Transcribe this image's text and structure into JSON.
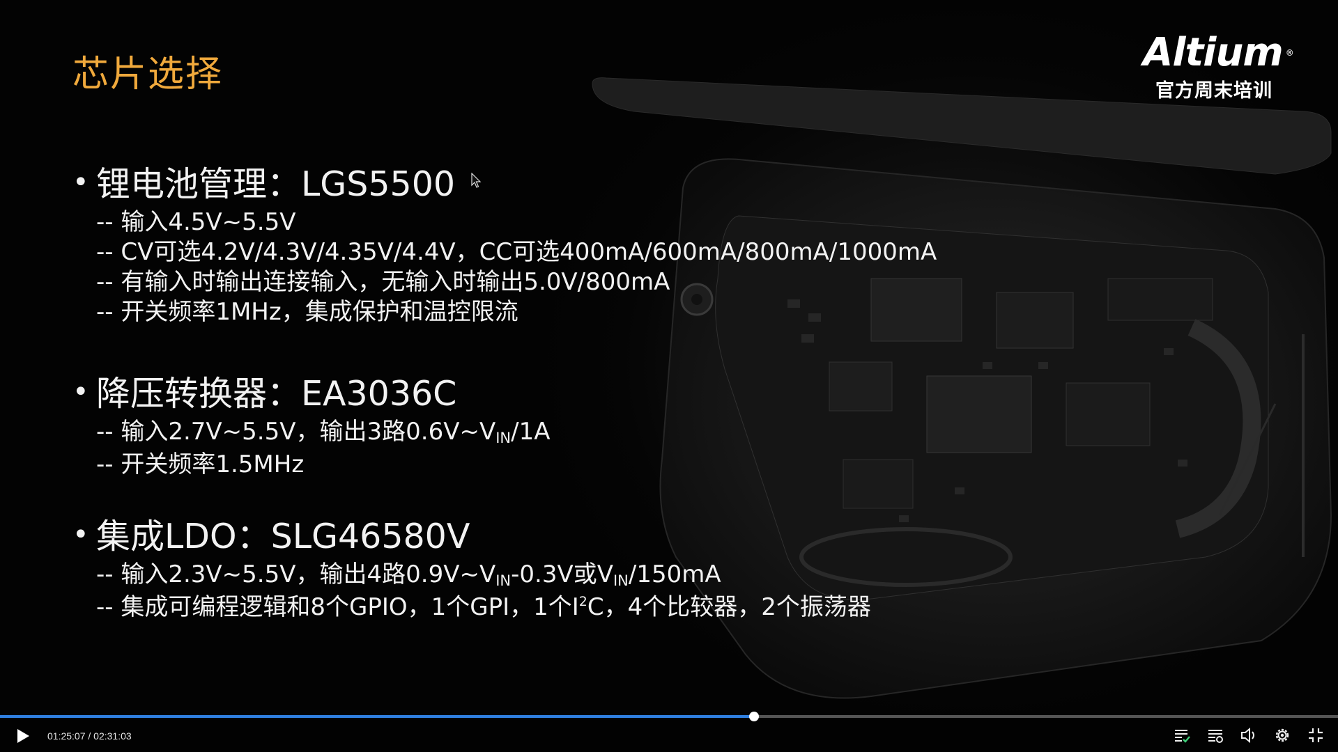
{
  "slide": {
    "title": "芯片选择",
    "logo": {
      "brand": "Altium",
      "registered": "®",
      "subtitle": "官方周末培训"
    },
    "sections": [
      {
        "heading": "锂电池管理：LGS5500",
        "items": [
          "-- 输入4.5V~5.5V",
          "-- CV可选4.2V/4.3V/4.35V/4.4V，CC可选400mA/600mA/800mA/1000mA",
          "-- 有输入时输出连接输入，无输入时输出5.0V/800mA",
          "-- 开关频率1MHz，集成保护和温控限流"
        ]
      },
      {
        "heading": "降压转换器：EA3036C",
        "items": [
          {
            "a": "-- 输入2.7V~5.5V，输出3路0.6V~V",
            "sub1": "IN",
            "b": "/1A"
          },
          "-- 开关频率1.5MHz"
        ]
      },
      {
        "heading": "集成LDO：SLG46580V",
        "items": [
          {
            "a": "-- 输入2.3V~5.5V，输出4路0.9V~V",
            "sub1": "IN",
            "b": "-0.3V或V",
            "sub2": "IN",
            "c": "/150mA"
          },
          {
            "a": "-- 集成可编程逻辑和8个GPIO，1个GPI，1个I",
            "sup": "2",
            "b": "C，4个比较器，2个振荡器"
          }
        ]
      }
    ]
  },
  "player": {
    "current_time": "01:25:07",
    "separator": " / ",
    "total_time": "02:31:03",
    "progress_fraction": 0.5635,
    "accent_color": "#2f7fe0",
    "buttons": [
      "play-icon",
      "chapters-icon",
      "playlist-icon",
      "volume-icon",
      "settings-icon",
      "fullscreen-icon"
    ]
  }
}
